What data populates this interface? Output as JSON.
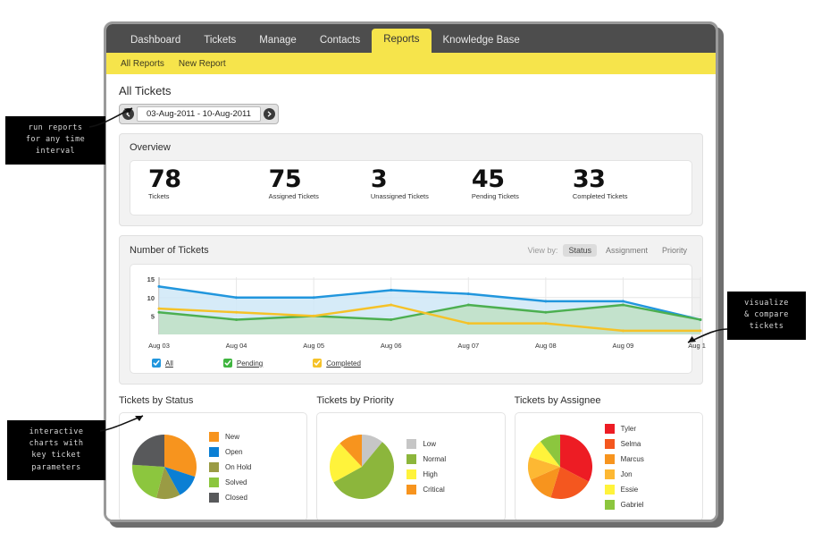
{
  "topnav": {
    "items": [
      {
        "label": "Dashboard",
        "active": false
      },
      {
        "label": "Tickets",
        "active": false
      },
      {
        "label": "Manage",
        "active": false
      },
      {
        "label": "Contacts",
        "active": false
      },
      {
        "label": "Reports",
        "active": true
      },
      {
        "label": "Knowledge Base",
        "active": false
      }
    ]
  },
  "subnav": {
    "items": [
      {
        "label": "All Reports"
      },
      {
        "label": "New Report"
      }
    ]
  },
  "page": {
    "title": "All Tickets",
    "date_range": "03-Aug-2011 - 10-Aug-2011",
    "prev_icon": "prev-arrow-icon",
    "next_icon": "next-arrow-icon"
  },
  "overview": {
    "title": "Overview",
    "stats": [
      {
        "value": "78",
        "label": "Tickets"
      },
      {
        "value": "75",
        "label": "Assigned Tickets"
      },
      {
        "value": "3",
        "label": "Unassigned Tickets"
      },
      {
        "value": "45",
        "label": "Pending Tickets"
      },
      {
        "value": "33",
        "label": "Completed Tickets"
      }
    ]
  },
  "tickets_panel": {
    "title": "Number of Tickets",
    "view_by_label": "View by:",
    "view_by_options": [
      {
        "label": "Status",
        "active": true
      },
      {
        "label": "Assignment",
        "active": false
      },
      {
        "label": "Priority",
        "active": false
      }
    ],
    "legend": [
      {
        "label": "All",
        "color": "#2196dd",
        "checked": true
      },
      {
        "label": "Pending",
        "color": "#3fb53f",
        "checked": true
      },
      {
        "label": "Completed",
        "color": "#f5c228",
        "checked": true
      }
    ]
  },
  "chart_data": [
    {
      "type": "line",
      "title": "Number of Tickets",
      "xlabel": "",
      "ylabel": "",
      "x": [
        "Aug 03",
        "Aug 04",
        "Aug 05",
        "Aug 06",
        "Aug 07",
        "Aug 08",
        "Aug 09",
        "Aug 1"
      ],
      "yticks": [
        5,
        10,
        15
      ],
      "ylim": [
        0,
        16
      ],
      "grid": true,
      "legend_position": "bottom",
      "series": [
        {
          "name": "All",
          "color": "#2196dd",
          "fill": "#cfe7f7",
          "values": [
            13,
            10,
            10,
            12,
            11,
            9,
            9,
            4
          ]
        },
        {
          "name": "Pending",
          "color": "#4caf50",
          "fill": "#bfe0c4",
          "values": [
            6,
            4,
            5,
            4,
            8,
            6,
            8,
            4
          ]
        },
        {
          "name": "Completed",
          "color": "#f5c228",
          "fill": "none",
          "values": [
            7,
            6,
            5,
            8,
            3,
            3,
            1,
            1
          ]
        }
      ]
    },
    {
      "type": "pie",
      "title": "Tickets by Status",
      "labels": [
        "New",
        "Open",
        "On Hold",
        "Solved",
        "Closed"
      ],
      "values": [
        30,
        12,
        12,
        22,
        24
      ],
      "colors": [
        "#f7941e",
        "#0b7fd4",
        "#9a9b44",
        "#8cc63e",
        "#58595b"
      ],
      "legend_position": "right"
    },
    {
      "type": "pie",
      "title": "Tickets by Priority",
      "labels": [
        "Low",
        "Normal",
        "High",
        "Critical"
      ],
      "values": [
        11,
        56,
        21,
        12
      ],
      "colors": [
        "#c6c6c6",
        "#8ab councils",
        "#ffef3d",
        "#f7941e"
      ],
      "legend_position": "right"
    },
    {
      "type": "pie",
      "title": "Tickets by Assignee",
      "labels": [
        "Tyler",
        "Selma",
        "Marcus",
        "Jon",
        "Essie",
        "Gabriel"
      ],
      "values": [
        31,
        21,
        13,
        11,
        9,
        10
      ],
      "colors": [
        "#ed1c24",
        "#f4571f",
        "#f7941e",
        "#fdb833",
        "#fff33b",
        "#8cc63e"
      ],
      "legend_position": "right"
    }
  ],
  "pies": [
    {
      "title": "Tickets by Status",
      "slices": [
        {
          "label": "New",
          "value": 30,
          "color": "#f7941e"
        },
        {
          "label": "Open",
          "value": 12,
          "color": "#0b7fd4"
        },
        {
          "label": "On Hold",
          "value": 12,
          "color": "#9a9b44"
        },
        {
          "label": "Solved",
          "value": 22,
          "color": "#8cc63e"
        },
        {
          "label": "Closed",
          "value": 24,
          "color": "#58595b"
        }
      ]
    },
    {
      "title": "Tickets by Priority",
      "slices": [
        {
          "label": "Low",
          "value": 11,
          "color": "#c6c6c6"
        },
        {
          "label": "Normal",
          "value": 56,
          "color": "#8cb63c"
        },
        {
          "label": "High",
          "value": 21,
          "color": "#fff33b"
        },
        {
          "label": "Critical",
          "value": 12,
          "color": "#f7941e"
        }
      ]
    },
    {
      "title": "Tickets by Assignee",
      "slices": [
        {
          "label": "Tyler",
          "value": 31,
          "color": "#ed1c24"
        },
        {
          "label": "Selma",
          "value": 21,
          "color": "#f4571f"
        },
        {
          "label": "Marcus",
          "value": 13,
          "color": "#f7941e"
        },
        {
          "label": "Jon",
          "value": 11,
          "color": "#fdb833"
        },
        {
          "label": "Essie",
          "value": 9,
          "color": "#fff33b"
        },
        {
          "label": "Gabriel",
          "value": 10,
          "color": "#8cc63e"
        }
      ]
    }
  ],
  "annotations": [
    {
      "id": "run-reports",
      "lines": [
        "run reports",
        "for any time",
        "interval"
      ]
    },
    {
      "id": "visualize",
      "lines": [
        "visualize",
        "& compare",
        "tickets"
      ]
    },
    {
      "id": "interactive",
      "lines": [
        "interactive",
        "charts with",
        "key ticket",
        "parameters"
      ]
    }
  ]
}
